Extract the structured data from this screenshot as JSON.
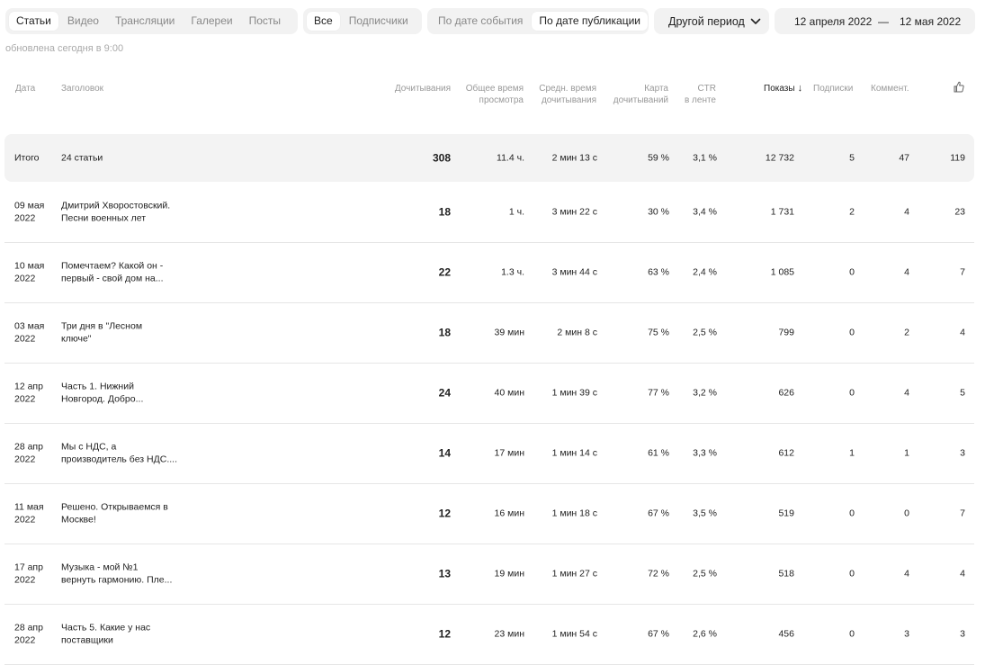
{
  "tabs": {
    "content_types": [
      {
        "label": "Статьи",
        "active": true
      },
      {
        "label": "Видео",
        "active": false
      },
      {
        "label": "Трансляции",
        "active": false
      },
      {
        "label": "Галереи",
        "active": false
      },
      {
        "label": "Посты",
        "active": false
      }
    ],
    "audience": [
      {
        "label": "Все",
        "active": true
      },
      {
        "label": "Подписчики",
        "active": false
      }
    ],
    "date_mode": [
      {
        "label": "По дате события",
        "active": false
      },
      {
        "label": "По дате публикации",
        "active": true
      }
    ]
  },
  "period": {
    "label": "Другой период",
    "icon": "chevron-down-icon"
  },
  "dates": {
    "from": "12 апреля 2022",
    "dash": "—",
    "to": "12 мая 2022"
  },
  "updated": "обновлена сегодня в 9:00",
  "headers": {
    "date": "Дата",
    "title": "Заголовок",
    "reads": "Дочитывания",
    "total_time_1": "Общее время",
    "total_time_2": "просмотра",
    "avg_time_1": "Средн. время",
    "avg_time_2": "дочитывания",
    "map_1": "Карта",
    "map_2": "дочитываний",
    "ctr_1": "CTR",
    "ctr_2": "в ленте",
    "views": "Показы",
    "subs": "Подписки",
    "comments": "Коммент.",
    "likes_icon": "thumbs-up-icon"
  },
  "total": {
    "date": "Итого",
    "title": "24 статьи",
    "reads": "308",
    "time": "11.4 ч.",
    "avg": "2 мин 13 с",
    "map": "59 %",
    "ctr": "3,1 %",
    "views": "12 732",
    "subs": "5",
    "comments": "47",
    "likes": "119"
  },
  "rows": [
    {
      "date1": "09 мая",
      "date2": "2022",
      "title1": "Дмитрий Хворостовский.",
      "title2": "Песни военных лет",
      "reads": "18",
      "time": "1 ч.",
      "avg": "3 мин 22 с",
      "map": "30 %",
      "ctr": "3,4 %",
      "views": "1 731",
      "subs": "2",
      "comments": "4",
      "likes": "23"
    },
    {
      "date1": "10 мая",
      "date2": "2022",
      "title1": "Помечтаем? Какой он -",
      "title2": "первый - свой дом на...",
      "reads": "22",
      "time": "1.3 ч.",
      "avg": "3 мин 44 с",
      "map": "63 %",
      "ctr": "2,4 %",
      "views": "1 085",
      "subs": "0",
      "comments": "4",
      "likes": "7"
    },
    {
      "date1": "03 мая",
      "date2": "2022",
      "title1": "Три дня в \"Лесном",
      "title2": "ключе\"",
      "reads": "18",
      "time": "39 мин",
      "avg": "2 мин 8 с",
      "map": "75 %",
      "ctr": "2,5 %",
      "views": "799",
      "subs": "0",
      "comments": "2",
      "likes": "4"
    },
    {
      "date1": "12 апр",
      "date2": "2022",
      "title1": "Часть 1. Нижний",
      "title2": "Новгород. Добро...",
      "reads": "24",
      "time": "40 мин",
      "avg": "1 мин 39 с",
      "map": "77 %",
      "ctr": "3,2 %",
      "views": "626",
      "subs": "0",
      "comments": "4",
      "likes": "5"
    },
    {
      "date1": "28 апр",
      "date2": "2022",
      "title1": "Мы с НДС, а",
      "title2": "производитель без НДС....",
      "reads": "14",
      "time": "17 мин",
      "avg": "1 мин 14 с",
      "map": "61 %",
      "ctr": "3,3 %",
      "views": "612",
      "subs": "1",
      "comments": "1",
      "likes": "3"
    },
    {
      "date1": "11 мая",
      "date2": "2022",
      "title1": "Решено. Открываемся в",
      "title2": "Москве!",
      "reads": "12",
      "time": "16 мин",
      "avg": "1 мин 18 с",
      "map": "67 %",
      "ctr": "3,5 %",
      "views": "519",
      "subs": "0",
      "comments": "0",
      "likes": "7"
    },
    {
      "date1": "17 апр",
      "date2": "2022",
      "title1": "Музыка - мой №1",
      "title2": "вернуть гармонию. Пле...",
      "reads": "13",
      "time": "19 мин",
      "avg": "1 мин 27 с",
      "map": "72 %",
      "ctr": "2,5 %",
      "views": "518",
      "subs": "0",
      "comments": "4",
      "likes": "4"
    },
    {
      "date1": "28 апр",
      "date2": "2022",
      "title1": "Часть 5. Какие у нас",
      "title2": "поставщики",
      "reads": "12",
      "time": "23 мин",
      "avg": "1 мин 54 с",
      "map": "67 %",
      "ctr": "2,6 %",
      "views": "456",
      "subs": "0",
      "comments": "3",
      "likes": "3"
    }
  ]
}
